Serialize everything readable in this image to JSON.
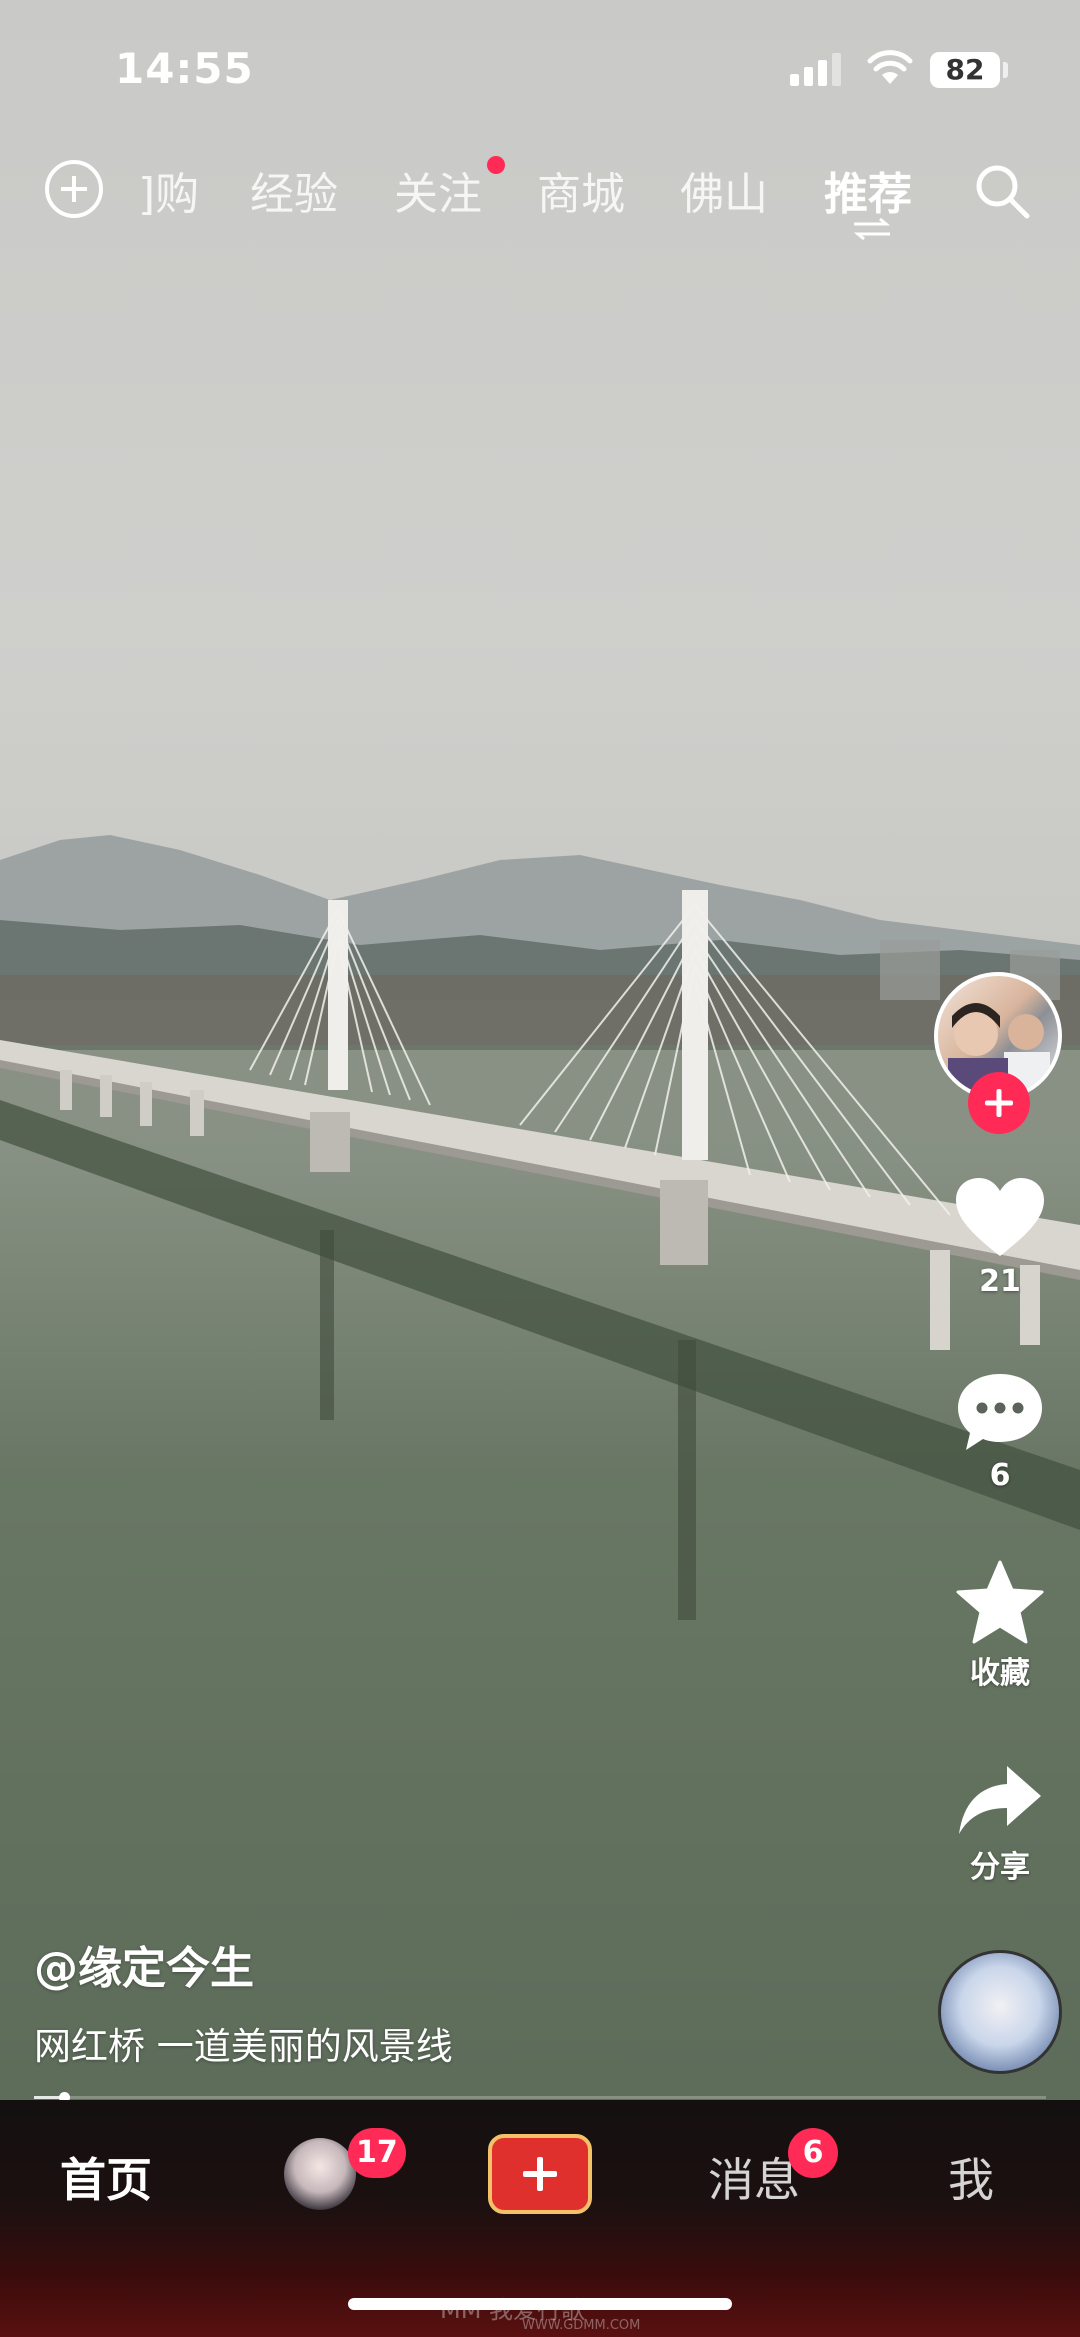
{
  "status_bar": {
    "time": "14:55",
    "battery": "82"
  },
  "top_nav": {
    "tabs": [
      {
        "label": "]购"
      },
      {
        "label": "经验"
      },
      {
        "label": "关注"
      },
      {
        "label": "商城"
      },
      {
        "label": "佛山"
      },
      {
        "label": "推荐",
        "active": true
      }
    ]
  },
  "side_actions": {
    "like_count": "21",
    "comment_count": "6",
    "favorite_label": "收藏",
    "share_label": "分享"
  },
  "video": {
    "author": "@缘定今生",
    "caption": "网红桥 一道美丽的风景线",
    "progress": 0.03
  },
  "bottom_nav": {
    "home_label": "首页",
    "friends_badge": "17",
    "messages_label": "消息",
    "messages_badge": "6",
    "me_label": "我"
  },
  "watermark": {
    "text": "MM 我爱行歌",
    "sub": "WWW.GDMM.COM"
  }
}
